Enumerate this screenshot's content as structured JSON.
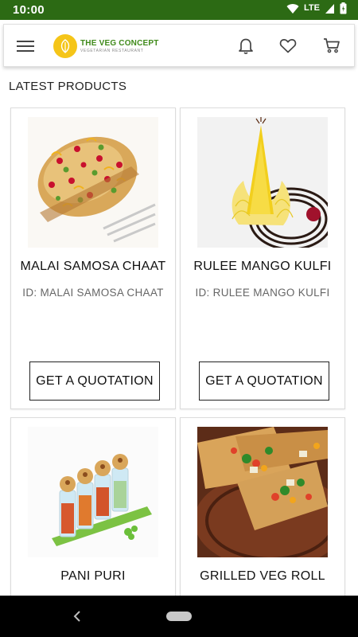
{
  "status_bar": {
    "time": "10:00",
    "network": "LTE"
  },
  "app_bar": {
    "logo_title": "THE VEG CONCEPT",
    "logo_subtitle": "VEGETARIAN RESTAURANT",
    "icons": [
      "menu-icon",
      "bell-icon",
      "heart-icon",
      "cart-icon"
    ]
  },
  "section_title": "LATEST PRODUCTS",
  "products": [
    {
      "name": "MALAI SAMOSA CHAAT",
      "id_label": "ID: MALAI SAMOSA CHAAT",
      "button": "GET A QUOTATION"
    },
    {
      "name": "RULEE MANGO KULFI",
      "id_label": "ID: RULEE MANGO KULFI",
      "button": "GET A QUOTATION"
    },
    {
      "name": "PANI PURI"
    },
    {
      "name": "GRILLED VEG ROLL"
    }
  ],
  "colors": {
    "status_bar": "#2c6a14",
    "brand_green": "#3f8a1a",
    "logo_yellow": "#f5c518"
  }
}
